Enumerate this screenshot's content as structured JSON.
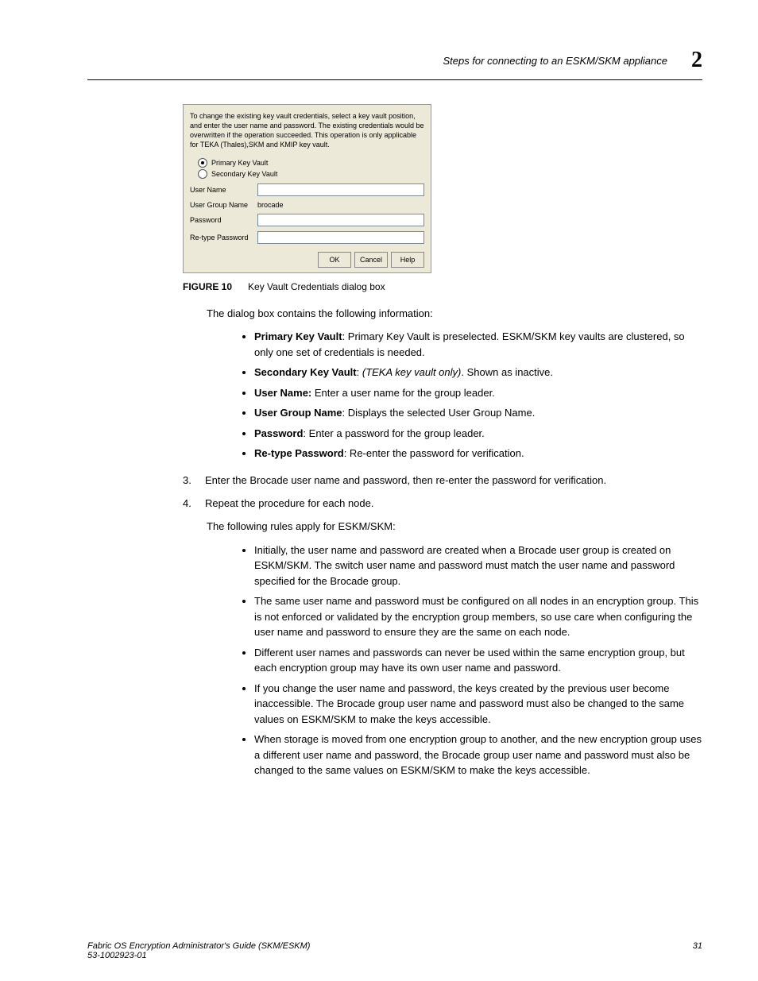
{
  "header": {
    "title": "Steps for connecting to an ESKM/SKM appliance",
    "chapter": "2"
  },
  "dialog": {
    "intro": "To change the existing key vault credentials, select a key vault position, and enter the user name and password. The existing credentials would be overwritten if the operation succeeded. This operation is only applicable for TEKA (Thales),SKM and KMIP key vault.",
    "radio_primary": "Primary Key Vault",
    "radio_secondary": "Secondary Key Vault",
    "labels": {
      "user_name": "User Name",
      "user_group": "User Group Name",
      "password": "Password",
      "retype": "Re-type Password"
    },
    "user_group_value": "brocade",
    "buttons": {
      "ok": "OK",
      "cancel": "Cancel",
      "help": "Help"
    }
  },
  "figure": {
    "label": "FIGURE 10",
    "caption": "Key Vault Credentials dialog box"
  },
  "intro_line": "The dialog box contains the following information:",
  "defs": {
    "pkv_label": "Primary Key Vault",
    "pkv_text": ": Primary Key Vault is preselected. ESKM/SKM key vaults are clustered, so only one set of credentials is needed.",
    "skv_label": "Secondary Key Vault",
    "skv_text_pre": ": ",
    "skv_text_ital": "(TEKA key vault only)",
    "skv_text_post": ". Shown as inactive.",
    "un_label": "User Name:",
    "un_text": " Enter a user name for the group leader.",
    "ugn_label": "User Group Name",
    "ugn_text": ": Displays the selected User Group Name.",
    "pw_label": "Password",
    "pw_text": ": Enter a password for the group leader.",
    "rpw_label": "Re-type Password",
    "rpw_text": ": Re-enter the password for verification."
  },
  "steps": {
    "s3_num": "3.",
    "s3": "Enter the Brocade user name and password, then re-enter the password for verification.",
    "s4_num": "4.",
    "s4": "Repeat the procedure for each node."
  },
  "rules_intro": "The following rules apply for ESKM/SKM:",
  "rules": {
    "r1": "Initially, the user name and password are created when a Brocade user group is created on ESKM/SKM. The switch user name and password must match the user name and password specified for the Brocade group.",
    "r2": "The same user name and password must be configured on all nodes in an encryption group. This is not enforced or validated by the encryption group members, so use care when configuring the user name and password to ensure they are the same on each node.",
    "r3": "Different user names and passwords can never be used within the same encryption group, but each encryption group may have its own user name and password.",
    "r4": "If you change the user name and password, the keys created by the previous user become inaccessible. The Brocade group user name and password must also be changed to the same values on ESKM/SKM to make the keys accessible.",
    "r5": "When storage is moved from one encryption group to another, and the new encryption group uses a different user name and password, the Brocade group user name and password must also be changed to the same values on ESKM/SKM to make the keys accessible."
  },
  "footer": {
    "book": "Fabric OS Encryption Administrator's Guide (SKM/ESKM)",
    "docnum": "53-1002923-01",
    "page": "31"
  }
}
